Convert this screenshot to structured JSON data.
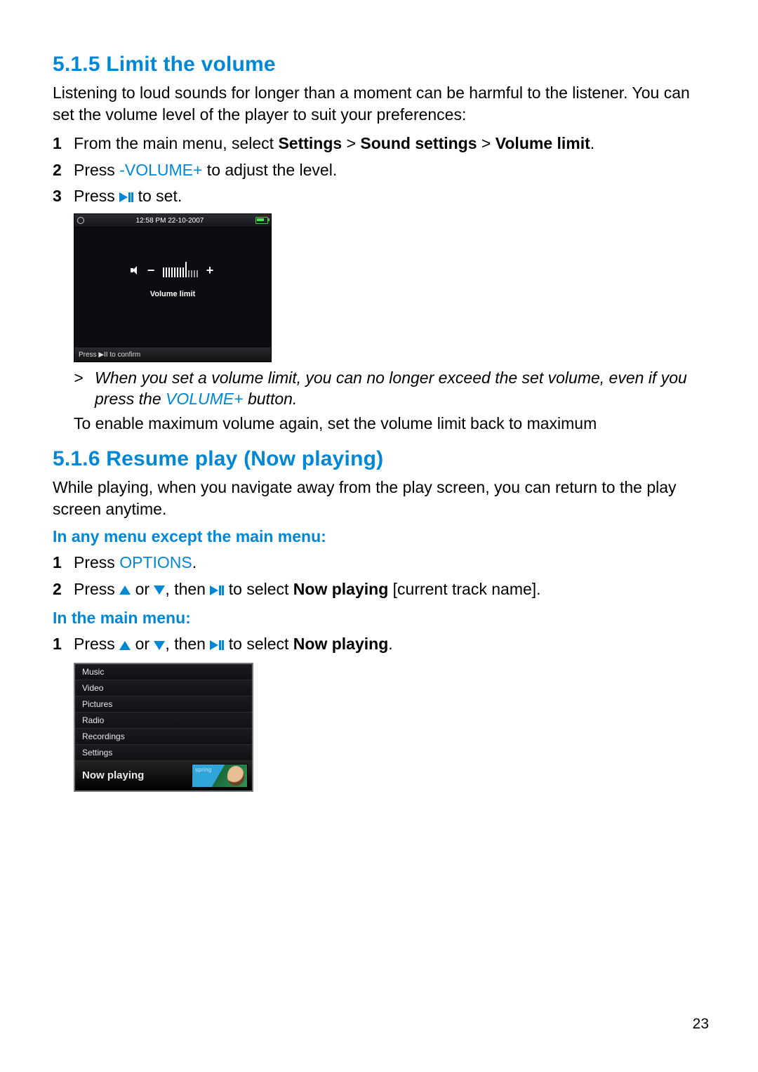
{
  "section515": {
    "heading": "5.1.5 Limit the volume",
    "intro": "Listening to loud sounds for longer than a moment can be harmful to the listener. You can set the volume level of the player to suit your preferences:",
    "step1_pre": "From the main menu, select ",
    "step1_b1": "Settings",
    "step1_sep": " > ",
    "step1_b2": "Sound settings",
    "step1_b3": "Volume limit",
    "step2_pre": "Press ",
    "step2_key": "-VOLUME+",
    "step2_post": " to adjust the level.",
    "step3_pre": "Press ",
    "step3_post": " to set.",
    "note_pre": "When you set a volume limit, you can no longer exceed the set volume, even if you press the ",
    "note_key": "VOLUME+",
    "note_post": " button.",
    "after": "To enable maximum volume again, set the volume limit back to maximum"
  },
  "volscreen": {
    "time": "12:58 PM  22-10-2007",
    "label": "Volume limit",
    "footer": "Press  ▶II  to confirm"
  },
  "section516": {
    "heading": "5.1.6 Resume play (Now playing)",
    "intro": "While playing, when you navigate away from the play screen, you can return to the play screen anytime.",
    "sub1": "In any menu except the main menu:",
    "s1_step1_pre": "Press ",
    "s1_step1_key": "OPTIONS",
    "s1_step1_post": ".",
    "s1_step2_pre": "Press ",
    "s1_step2_mid1": " or ",
    "s1_step2_mid2": ", then ",
    "s1_step2_post1": " to select ",
    "s1_step2_bold": "Now playing",
    "s1_step2_post2": " [current track name].",
    "sub2": "In the main menu:",
    "s2_step1_pre": "Press ",
    "s2_step1_mid1": " or ",
    "s2_step1_mid2": ", then ",
    "s2_step1_post1": " to select ",
    "s2_step1_bold": "Now playing",
    "s2_step1_post2": "."
  },
  "menuscreen": {
    "items": [
      "Music",
      "Video",
      "Pictures",
      "Radio",
      "Recordings",
      "Settings"
    ],
    "nowplaying": "Now playing",
    "art_text": "spring"
  },
  "pagenum": "23",
  "nums": {
    "n1": "1",
    "n2": "2",
    "n3": "3"
  }
}
